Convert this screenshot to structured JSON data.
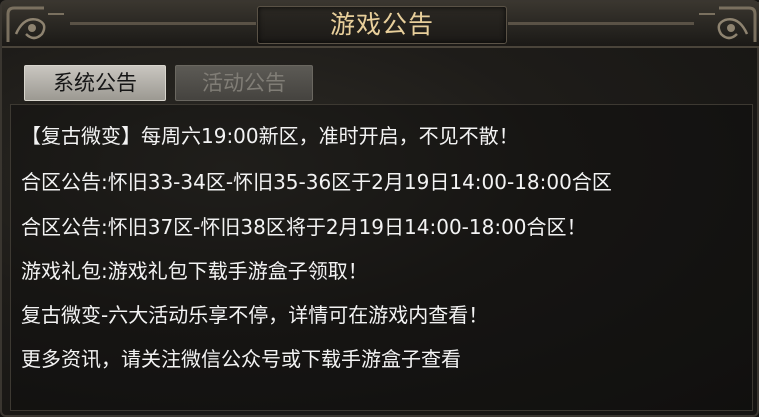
{
  "header": {
    "title": "游戏公告"
  },
  "tabs": [
    {
      "label": "系统公告",
      "active": true
    },
    {
      "label": "活动公告",
      "active": false
    }
  ],
  "notices": [
    "【复古微变】每周六19:00新区，准时开启，不见不散！",
    "合区公告:怀旧33-34区-怀旧35-36区于2月19日14:00-18:00合区",
    "合区公告:怀旧37区-怀旧38区将于2月19日14:00-18:00合区！",
    "游戏礼包:游戏礼包下载手游盒子领取！",
    "复古微变-六大活动乐享不停，详情可在游戏内查看！",
    "更多资讯，请关注微信公众号或下载手游盒子查看"
  ],
  "colors": {
    "title_text": "#e8cf9b",
    "notice_text": "#f3f3f3",
    "active_tab_bg": "#b3b0a9",
    "inactive_tab_text": "#807d76"
  }
}
